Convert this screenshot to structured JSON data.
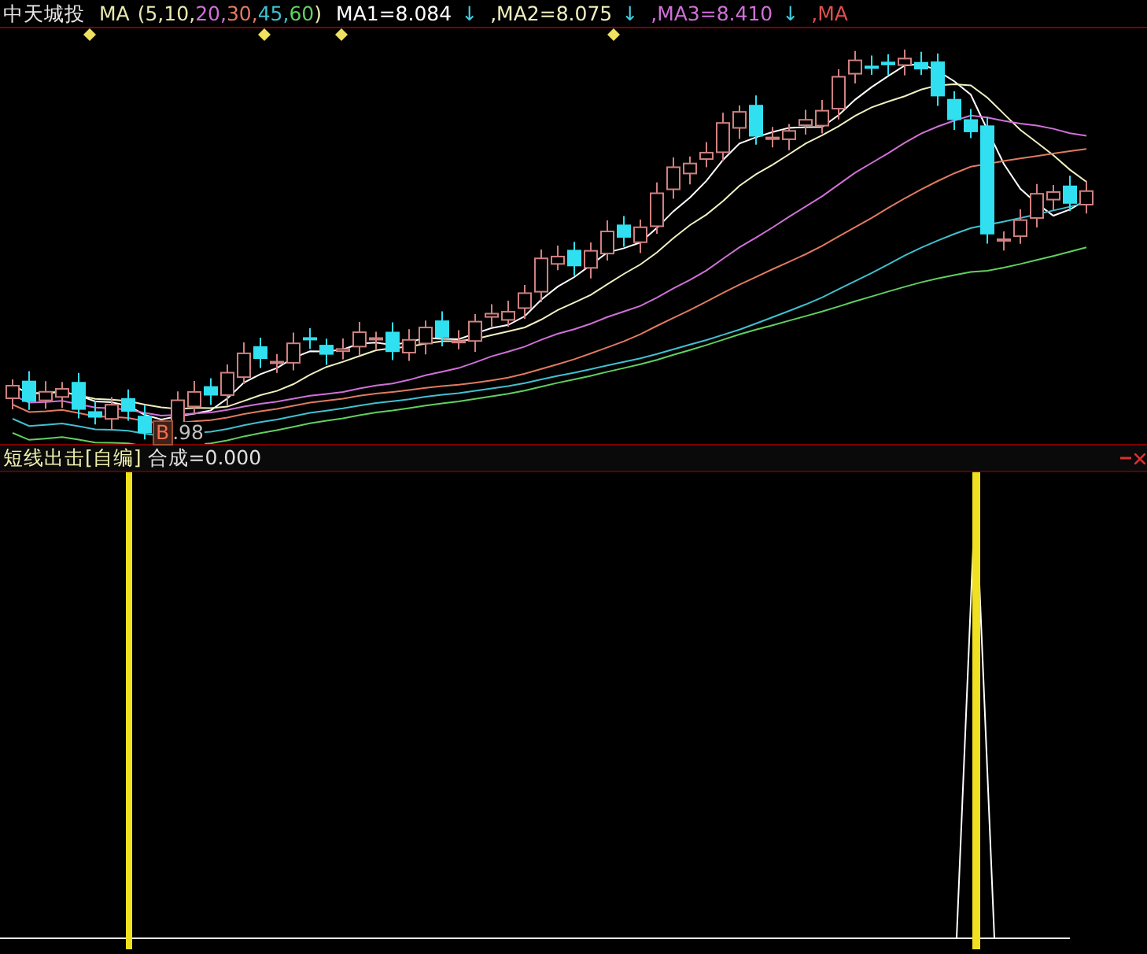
{
  "stock": {
    "name": "中天城投"
  },
  "ma_legend": {
    "label": "MA",
    "open": "(",
    "close": ")",
    "params": [
      {
        "text": "5,",
        "color": "#e8e8b0"
      },
      {
        "text": "10,",
        "color": "#e8e8b0"
      },
      {
        "text": "20,",
        "color": "#d070d8"
      },
      {
        "text": "30,",
        "color": "#e07a60"
      },
      {
        "text": "45,",
        "color": "#40c0d0"
      },
      {
        "text": "60",
        "color": "#60d060"
      }
    ]
  },
  "ma_values": [
    {
      "text": "MA1=8.084",
      "arrow": "↓",
      "color": "#ffffff"
    },
    {
      "text": ",MA2=8.075",
      "arrow": "↓",
      "color": "#f0f0c0"
    },
    {
      "text": ",MA3=8.410",
      "arrow": "↓",
      "color": "#d070d8"
    },
    {
      "text": ",MA",
      "color": "#e05050"
    }
  ],
  "signal": {
    "letter": "B",
    "price": ".98"
  },
  "lower_panel": {
    "title": "短线出击[自编]",
    "value": "合成=0.000"
  }
}
